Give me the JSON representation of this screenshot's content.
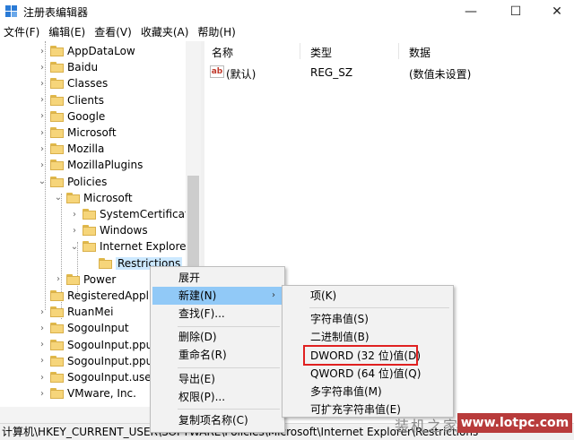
{
  "window": {
    "title": "注册表编辑器",
    "minimize_glyph": "—",
    "maximize_glyph": "☐",
    "close_glyph": "✕"
  },
  "menu": [
    "文件(F)",
    "编辑(E)",
    "查看(V)",
    "收藏夹(A)",
    "帮助(H)"
  ],
  "tree": [
    {
      "label": "AppDataLow",
      "level": 0,
      "expander": "›"
    },
    {
      "label": "Baidu",
      "level": 0,
      "expander": "›"
    },
    {
      "label": "Classes",
      "level": 0,
      "expander": "›"
    },
    {
      "label": "Clients",
      "level": 0,
      "expander": "›"
    },
    {
      "label": "Google",
      "level": 0,
      "expander": "›"
    },
    {
      "label": "Microsoft",
      "level": 0,
      "expander": "›"
    },
    {
      "label": "Mozilla",
      "level": 0,
      "expander": "›"
    },
    {
      "label": "MozillaPlugins",
      "level": 0,
      "expander": "›"
    },
    {
      "label": "Policies",
      "level": 0,
      "expander": "⌄"
    },
    {
      "label": "Microsoft",
      "level": 1,
      "expander": "⌄"
    },
    {
      "label": "SystemCertificates",
      "level": 2,
      "expander": "›"
    },
    {
      "label": "Windows",
      "level": 2,
      "expander": "›"
    },
    {
      "label": "Internet Explorer",
      "level": 2,
      "expander": "⌄"
    },
    {
      "label": "Restrictions",
      "level": 3,
      "expander": "",
      "selected": true
    },
    {
      "label": "Power",
      "level": 1,
      "expander": "›"
    },
    {
      "label": "RegisteredApplic",
      "level": 0,
      "expander": ""
    },
    {
      "label": "RuanMei",
      "level": 0,
      "expander": "›"
    },
    {
      "label": "SogouInput",
      "level": 0,
      "expander": "›"
    },
    {
      "label": "SogouInput.ppup",
      "level": 0,
      "expander": "›"
    },
    {
      "label": "SogouInput.ppup",
      "level": 0,
      "expander": "›"
    },
    {
      "label": "SogouInput.user",
      "level": 0,
      "expander": "›"
    },
    {
      "label": "VMware, Inc.",
      "level": 0,
      "expander": "›"
    }
  ],
  "list": {
    "columns": [
      "名称",
      "类型",
      "数据"
    ],
    "rows": [
      {
        "icon": "ab",
        "name": "(默认)",
        "type": "REG_SZ",
        "data": "(数值未设置)"
      }
    ]
  },
  "context_menu": {
    "items": [
      "展开",
      "新建(N)",
      "查找(F)...",
      "删除(D)",
      "重命名(R)",
      "导出(E)",
      "权限(P)...",
      "复制项名称(C)"
    ],
    "submenu_arrow": "›"
  },
  "submenu": {
    "items": [
      "项(K)",
      "字符串值(S)",
      "二进制值(B)",
      "DWORD (32 位)值(D)",
      "QWORD (64 位)值(Q)",
      "多字符串值(M)",
      "可扩充字符串值(E)"
    ],
    "highlighted_item": "DWORD (32 位)值(D)",
    "highlight_color": "#e02020"
  },
  "statusbar": {
    "path": "计算机\\HKEY_CURRENT_USER\\SOFTWARE\\Policies\\Microsoft\\Internet Explorer\\Restrictions"
  },
  "watermark": {
    "text": "装机之家",
    "url": "www.lotpc.com"
  }
}
